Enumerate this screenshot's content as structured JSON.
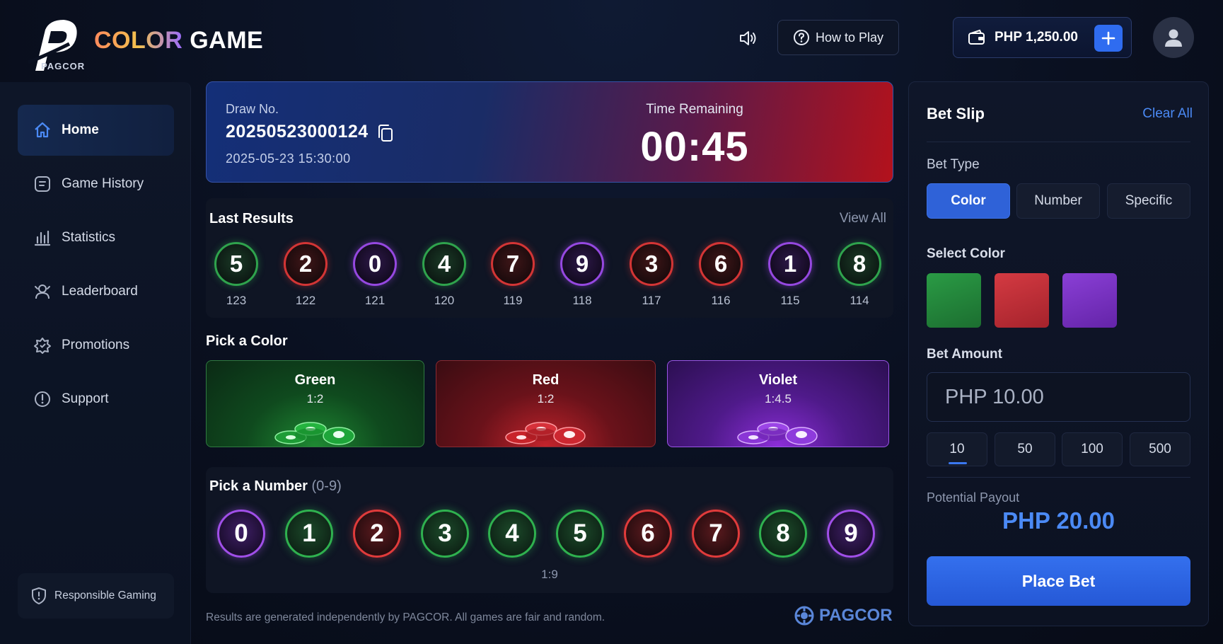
{
  "header": {
    "logo_sub": "PAGCOR",
    "brand_part1": "COLOR",
    "brand_part2": "GAME",
    "how_to_play": "How to Play",
    "wallet_amount": "PHP 1,250.00"
  },
  "sidebar": {
    "items": [
      {
        "label": "Home",
        "icon": "home-icon",
        "active": true
      },
      {
        "label": "Game History",
        "icon": "history-icon"
      },
      {
        "label": "Statistics",
        "icon": "statistics-icon"
      },
      {
        "label": "Leaderboard",
        "icon": "leaderboard-icon"
      },
      {
        "label": "Promotions",
        "icon": "promotions-icon"
      },
      {
        "label": "Support",
        "icon": "support-icon"
      }
    ],
    "responsible": "Responsible Gaming"
  },
  "draw": {
    "label": "Draw No.",
    "number": "20250523000124",
    "datetime": "2025-05-23 15:30:00",
    "remaining_label": "Time Remaining",
    "remaining": "00:45"
  },
  "last_results": {
    "title": "Last Results",
    "view_all": "View All",
    "results": [
      {
        "value": "5",
        "color": "green",
        "draw": "123"
      },
      {
        "value": "2",
        "color": "red",
        "draw": "122"
      },
      {
        "value": "0",
        "color": "violet",
        "draw": "121"
      },
      {
        "value": "4",
        "color": "green",
        "draw": "120"
      },
      {
        "value": "7",
        "color": "red",
        "draw": "119"
      },
      {
        "value": "9",
        "color": "violet",
        "draw": "118"
      },
      {
        "value": "3",
        "color": "red",
        "draw": "117"
      },
      {
        "value": "6",
        "color": "red",
        "draw": "116"
      },
      {
        "value": "1",
        "color": "violet",
        "draw": "115"
      },
      {
        "value": "8",
        "color": "green",
        "draw": "114"
      }
    ]
  },
  "pick_color": {
    "title": "Pick a Color",
    "options": [
      {
        "name": "Green",
        "odds": "1:2"
      },
      {
        "name": "Red",
        "odds": "1:2"
      },
      {
        "name": "Violet",
        "odds": "1:4.5"
      }
    ]
  },
  "pick_number": {
    "title": "Pick a Number",
    "range": "(0-9)",
    "odds": "1:9",
    "numbers": [
      {
        "value": "0",
        "color": "violet"
      },
      {
        "value": "1",
        "color": "green"
      },
      {
        "value": "2",
        "color": "red"
      },
      {
        "value": "3",
        "color": "green"
      },
      {
        "value": "4",
        "color": "green"
      },
      {
        "value": "5",
        "color": "green"
      },
      {
        "value": "6",
        "color": "red"
      },
      {
        "value": "7",
        "color": "red"
      },
      {
        "value": "8",
        "color": "green"
      },
      {
        "value": "9",
        "color": "violet"
      }
    ]
  },
  "footer": {
    "note": "Results are generated independently by PAGCOR. All games are fair and random.",
    "logo": "PAGCOR"
  },
  "bet_slip": {
    "title": "Bet Slip",
    "clear_all": "Clear All",
    "bet_type_label": "Bet Type",
    "bet_types": [
      "Color",
      "Number",
      "Specific"
    ],
    "select_color_label": "Select Color",
    "bet_amount_label": "Bet Amount",
    "amount_placeholder": "PHP 10.00",
    "quick_amounts": [
      "10",
      "50",
      "100",
      "500"
    ],
    "potential_payout_label": "Potential Payout",
    "potential_payout": "PHP 20.00",
    "place_bet": "Place Bet"
  },
  "colors": {
    "green": "#2fa34d",
    "red": "#d33535",
    "violet": "#9548e0",
    "accent": "#2f62d8"
  }
}
